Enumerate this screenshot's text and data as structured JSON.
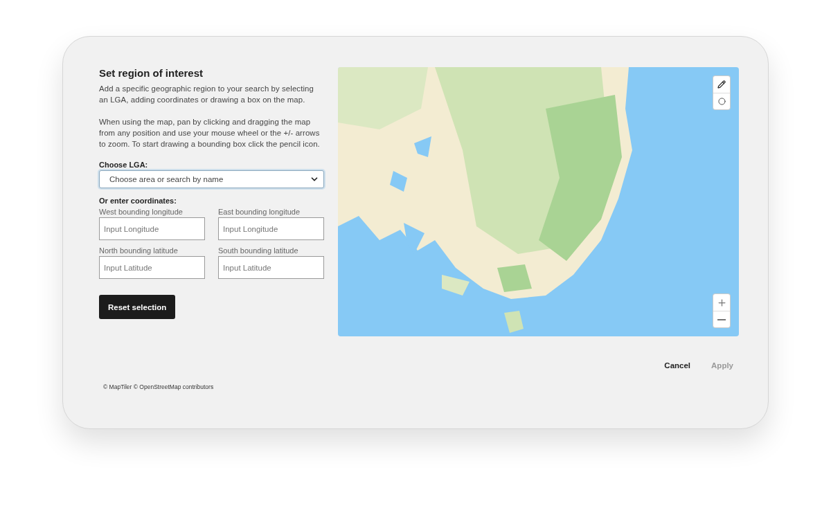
{
  "dialog": {
    "title": "Set region of interest",
    "paragraphs": [
      "Add a specific geographic region to your search by selecting an LGA, adding coordinates or drawing a box on the map.",
      "When using the map, pan by clicking and dragging the map from any position and use your mouse wheel or the +/- arrows to zoom. To start drawing a bounding box click the pencil icon."
    ],
    "lga": {
      "label": "Choose LGA:",
      "placeholder": "Choose area or search by name"
    },
    "coordinates": {
      "heading": "Or enter coordinates:",
      "fields": [
        {
          "label": "West bounding longitude",
          "placeholder": "Input Longitude"
        },
        {
          "label": "East bounding longitude",
          "placeholder": "Input Longitude"
        },
        {
          "label": "North bounding latitude",
          "placeholder": "Input Latitude"
        },
        {
          "label": "South bounding latitude",
          "placeholder": "Input Latitude"
        }
      ]
    },
    "reset_button": "Reset selection",
    "actions": [
      {
        "label": "Cancel",
        "disabled": false
      },
      {
        "label": "Apply",
        "disabled": true
      }
    ],
    "attribution": "© MapTiler © OpenStreetMap contributors"
  }
}
